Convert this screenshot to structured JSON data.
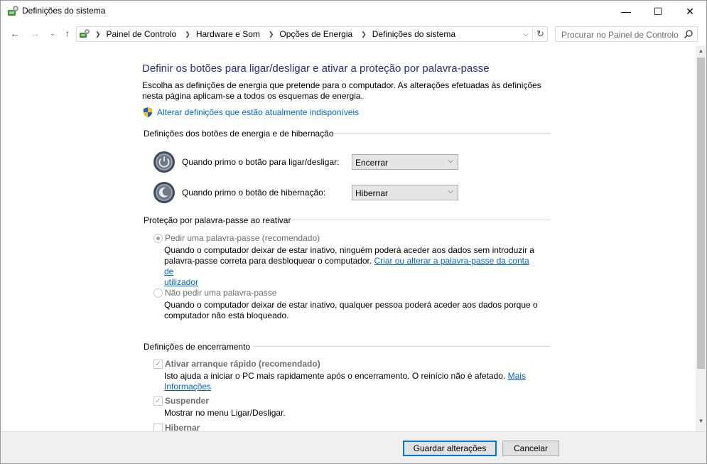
{
  "window": {
    "title": "Definições do sistema",
    "min_glyph": "—",
    "max_glyph": "☐",
    "close_glyph": "✕"
  },
  "nav": {
    "back_glyph": "←",
    "forward_glyph": "→",
    "recent_glyph": "⌄",
    "up_glyph": "↑",
    "breadcrumbs": [
      "Painel de Controlo",
      "Hardware e Som",
      "Opções de Energia",
      "Definições do sistema"
    ],
    "refresh_glyph": "↻",
    "search_placeholder": "Procurar no Painel de Controlo"
  },
  "main": {
    "heading": "Definir os botões para ligar/desligar e ativar a proteção por palavra-passe",
    "intro": "Escolha as definições de energia que pretende para o computador. As alterações efetuadas às definições nesta página aplicam-se a todos os esquemas de energia.",
    "admin_link": "Alterar definições que estão atualmente indisponíveis",
    "power_section": {
      "title": "Definições dos botões de energia e de hibernação",
      "power_button_label": "Quando primo o botão para ligar/desligar:",
      "power_button_value": "Encerrar",
      "sleep_button_label": "Quando primo o botão de hibernação:",
      "sleep_button_value": "Hibernar"
    },
    "password_section": {
      "title": "Proteção por palavra-passe ao reativar",
      "option_require_label": "Pedir uma palavra-passe (recomendado)",
      "option_require_selected": true,
      "option_require_desc_1": "Quando o computador deixar de estar inativo, ninguém poderá aceder aos dados sem introduzir a",
      "option_require_desc_2": "palavra-passe correta para desbloquear o computador. ",
      "option_require_link_1": "Criar ou alterar a palavra-passe da conta de",
      "option_require_link_2": "utilizador",
      "option_none_label": "Não pedir uma palavra-passe",
      "option_none_selected": false,
      "option_none_desc": "Quando o computador deixar de estar inativo, qualquer pessoa poderá aceder aos dados porque o computador não está bloqueado."
    },
    "shutdown_section": {
      "title": "Definições de encerramento",
      "fast_startup_label": "Ativar arranque rápido (recomendado)",
      "fast_startup_checked": true,
      "fast_startup_desc": "Isto ajuda a iniciar o PC mais rapidamente após o encerramento. O reinício não é afetado. ",
      "fast_startup_link_1": "Mais",
      "fast_startup_link_2": "Informações",
      "sleep_label": "Suspender",
      "sleep_checked": true,
      "sleep_desc": "Mostrar no menu Ligar/Desligar.",
      "hibernate_label": "Hibernar",
      "hibernate_checked": false
    }
  },
  "footer": {
    "save_label": "Guardar alterações",
    "cancel_label": "Cancelar"
  },
  "colors": {
    "heading": "#1e3287",
    "link": "#0066cc",
    "footer_bg": "#f0f0f0"
  }
}
